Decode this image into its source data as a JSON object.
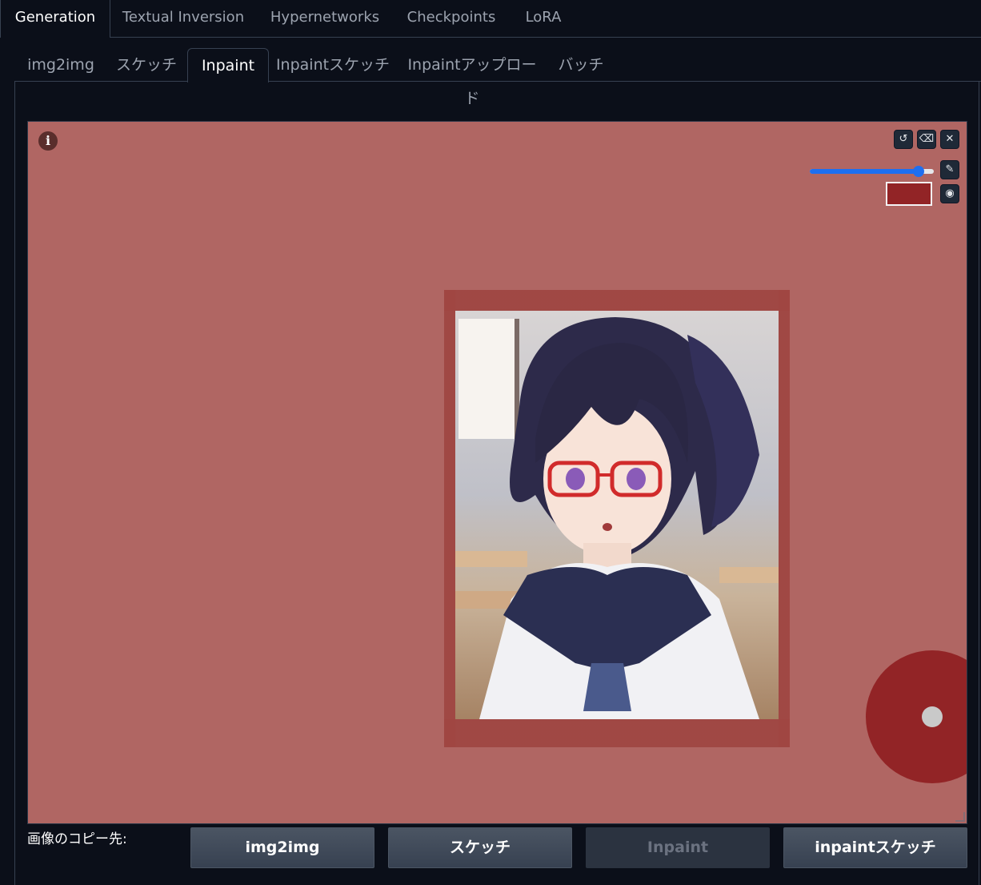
{
  "top_tabs": [
    {
      "label": "Generation",
      "active": true
    },
    {
      "label": "Textual Inversion",
      "active": false
    },
    {
      "label": "Hypernetworks",
      "active": false
    },
    {
      "label": "Checkpoints",
      "active": false
    },
    {
      "label": "LoRA",
      "active": false
    }
  ],
  "sub_tabs": [
    {
      "label": "img2img",
      "active": false
    },
    {
      "label": "スケッチ",
      "active": false
    },
    {
      "label": "Inpaint",
      "active": true
    },
    {
      "label": "Inpaintスケッチ",
      "active": false
    },
    {
      "label": "Inpaintアップロード",
      "active": false
    },
    {
      "label": "バッチ",
      "active": false
    }
  ],
  "canvas": {
    "info_icon": "info-icon",
    "tools": [
      "undo-icon",
      "eraser-icon",
      "close-icon"
    ],
    "brush_icon": "brush-icon",
    "palette_icon": "palette-icon",
    "brush_size_fraction": 0.88,
    "brush_color": "#922426",
    "mask_color": "#b06663"
  },
  "copy_to": {
    "label": "画像のコピー先:",
    "buttons": [
      {
        "label": "img2img",
        "disabled": false
      },
      {
        "label": "スケッチ",
        "disabled": false
      },
      {
        "label": "Inpaint",
        "disabled": true
      },
      {
        "label": "inpaintスケッチ",
        "disabled": false
      }
    ]
  }
}
